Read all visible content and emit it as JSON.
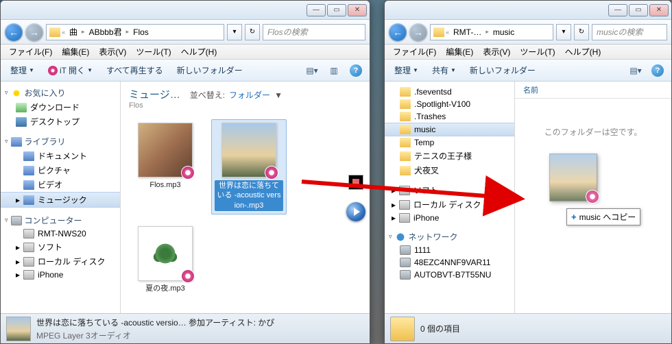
{
  "window_left": {
    "titlebar": {
      "min": "—",
      "max": "▭",
      "close": "✕"
    },
    "nav": {
      "back": "←",
      "forward": "→",
      "breadcrumbs": [
        "曲",
        "ABbbb君",
        "Flos"
      ],
      "refresh": "↻",
      "search_placeholder": "Flosの検索"
    },
    "menu": [
      "ファイル(F)",
      "編集(E)",
      "表示(V)",
      "ツール(T)",
      "ヘルプ(H)"
    ],
    "toolbar": {
      "organize": "整理",
      "open": "iT 開く",
      "play_all": "すべて再生する",
      "new_folder": "新しいフォルダー",
      "help": "?"
    },
    "sidebar": {
      "favorites": {
        "label": "お気に入り",
        "items": [
          "ダウンロード",
          "デスクトップ"
        ]
      },
      "libraries": {
        "label": "ライブラリ",
        "items": [
          "ドキュメント",
          "ピクチャ",
          "ビデオ",
          "ミュージック"
        ],
        "selected": "ミュージック"
      },
      "computer": {
        "label": "コンピューター",
        "items": [
          "RMT-NWS20",
          "ソフト",
          "ローカル ディスク",
          "iPhone"
        ]
      }
    },
    "content": {
      "title": "ミュージ…",
      "subtitle": "Flos",
      "sort_label": "並べ替え:",
      "sort_value": "フォルダー",
      "files": [
        {
          "name": "Flos.mp3",
          "art": "art1"
        },
        {
          "name": "世界は恋に落ちている -acoustic version-.mp3",
          "art": "art2",
          "selected": true
        },
        {
          "name": "夏の夜.mp3",
          "art": "art3"
        }
      ]
    },
    "status": {
      "line1": "世界は恋に落ちている -acoustic versio…  参加アーティスト: かぴ",
      "line2": "MPEG Layer 3オーディオ"
    }
  },
  "window_right": {
    "titlebar": {
      "min": "—",
      "max": "▭",
      "close": "✕"
    },
    "nav": {
      "back": "←",
      "forward": "→",
      "breadcrumbs": [
        "RMT-…",
        "music"
      ],
      "refresh": "↻",
      "search_placeholder": "musicの検索"
    },
    "menu": [
      "ファイル(F)",
      "編集(E)",
      "表示(V)",
      "ツール(T)",
      "ヘルプ(H)"
    ],
    "toolbar": {
      "organize": "整理",
      "share": "共有",
      "new_folder": "新しいフォルダー",
      "help": "?"
    },
    "sidebar": {
      "folders": [
        ".fseventsd",
        ".Spotlight-V100",
        ".Trashes",
        "music",
        "Temp",
        "テニスの王子様",
        "犬夜叉"
      ],
      "folders_selected": "music",
      "drives": [
        "ソフト",
        "ローカル ディスク",
        "iPhone"
      ],
      "network": {
        "label": "ネットワーク",
        "items": [
          "1111",
          "48EZC4NNF9VAR11",
          "AUTOBVT-B7T55NU"
        ]
      }
    },
    "content": {
      "column_header": "名前",
      "empty": "このフォルダーは空です。"
    },
    "drag": {
      "tooltip": "music へコピー",
      "plus": "+"
    },
    "status": {
      "line1": "0 個の項目"
    }
  }
}
